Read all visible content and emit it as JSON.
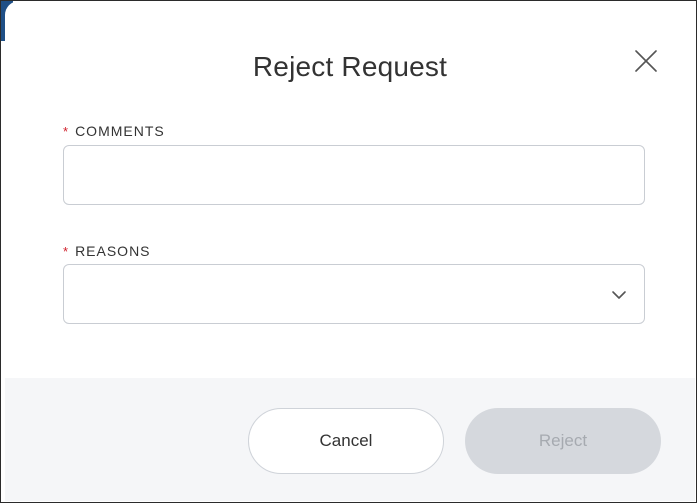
{
  "dialog": {
    "title": "Reject Request",
    "close_icon": "close-icon"
  },
  "form": {
    "comments": {
      "required_mark": "*",
      "label": "COMMENTS",
      "value": "",
      "placeholder": ""
    },
    "reasons": {
      "required_mark": "*",
      "label": "REASONS",
      "selected": "",
      "dropdown_icon": "chevron-down-icon"
    }
  },
  "footer": {
    "cancel_label": "Cancel",
    "reject_label": "Reject",
    "reject_disabled": true
  },
  "colors": {
    "required": "#d0202c",
    "disabled_button_bg": "#d5d8dd",
    "disabled_button_text": "#a6aab0",
    "footer_bg": "#f5f6f8"
  }
}
